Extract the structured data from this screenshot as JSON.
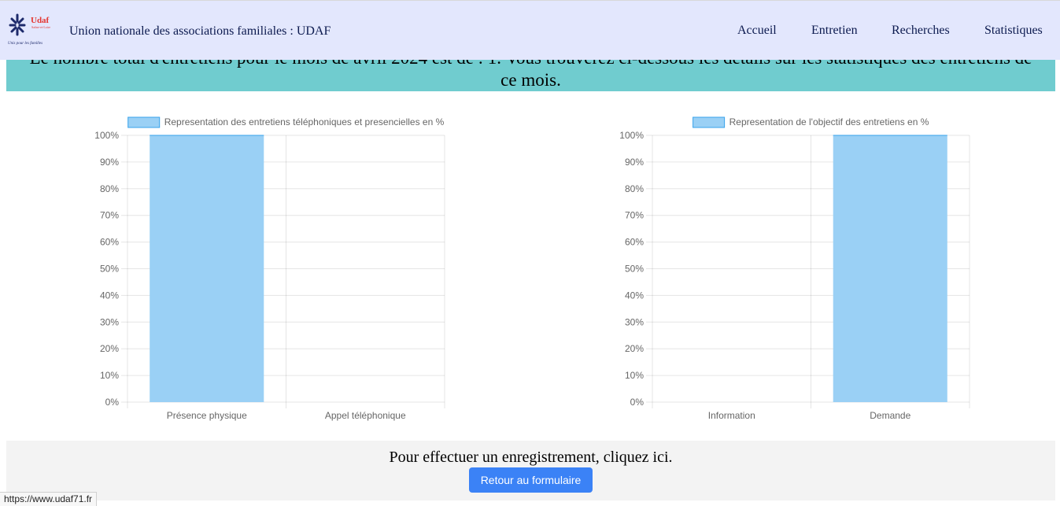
{
  "banner": {
    "line1": "Le nombre total d'entretiens pour le mois de avril 2024 est de : 1. Vous trouverez ci-dessous les détails sur les statistiques des entretiens de",
    "line2": "ce mois."
  },
  "navbar": {
    "logo_text": "Udaf",
    "logo_sub": "Saône-et-Loire",
    "logo_tagline": "Unis pour les familles",
    "brand": "Union nationale des associations familiales : UDAF",
    "items": [
      {
        "label": "Accueil"
      },
      {
        "label": "Entretien"
      },
      {
        "label": "Recherches"
      },
      {
        "label": "Statistiques"
      }
    ]
  },
  "chart_data": [
    {
      "type": "bar",
      "legend": "Representation des entretiens téléphoniques et presencielles en %",
      "categories": [
        "Présence physique",
        "Appel téléphonique"
      ],
      "values": [
        100,
        0
      ],
      "ylim": [
        0,
        100
      ],
      "yticks": [
        "0%",
        "10%",
        "20%",
        "30%",
        "40%",
        "50%",
        "60%",
        "70%",
        "80%",
        "90%",
        "100%"
      ],
      "grid": true,
      "legend_position": "top",
      "bar_color": "#9ad0f5",
      "bar_border_color": "#36a2eb"
    },
    {
      "type": "bar",
      "legend": "Representation de l'objectif des entretiens en %",
      "categories": [
        "Information",
        "Demande"
      ],
      "values": [
        0,
        100
      ],
      "ylim": [
        0,
        100
      ],
      "yticks": [
        "0%",
        "10%",
        "20%",
        "30%",
        "40%",
        "50%",
        "60%",
        "70%",
        "80%",
        "90%",
        "100%"
      ],
      "grid": true,
      "legend_position": "top",
      "bar_color": "#9ad0f5",
      "bar_border_color": "#36a2eb"
    }
  ],
  "footer": {
    "text": "Pour effectuer un enregistrement, cliquez ici.",
    "button_label": "Retour au formulaire"
  },
  "status": {
    "url": "https://www.udaf71.fr"
  }
}
